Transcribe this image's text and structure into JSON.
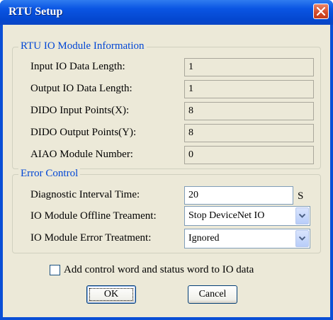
{
  "window": {
    "title": "RTU Setup"
  },
  "info_group": {
    "title": "RTU IO Module Information",
    "rows": [
      {
        "label": "Input IO Data Length:",
        "value": "1"
      },
      {
        "label": "Output IO Data Length:",
        "value": "1"
      },
      {
        "label": "DIDO Input Points(X):",
        "value": "8"
      },
      {
        "label": "DIDO Output Points(Y):",
        "value": "8"
      },
      {
        "label": "AIAO Module Number:",
        "value": "0"
      }
    ]
  },
  "error_group": {
    "title": "Error Control",
    "diag_label": "Diagnostic Interval Time:",
    "diag_value": "20",
    "diag_unit": "S",
    "offline_label": "IO Module Offline Treament:",
    "offline_value": "Stop DeviceNet IO",
    "error_label": "IO Module Error Treatment:",
    "error_value": "Ignored"
  },
  "checkbox": {
    "label": "Add control word and status word to IO data",
    "checked": false
  },
  "buttons": {
    "ok": "OK",
    "cancel": "Cancel"
  },
  "colors": {
    "titlebar": "#0a55e3",
    "group_title": "#0046d5",
    "client": "#ece9d8",
    "close": "#d24a28"
  }
}
